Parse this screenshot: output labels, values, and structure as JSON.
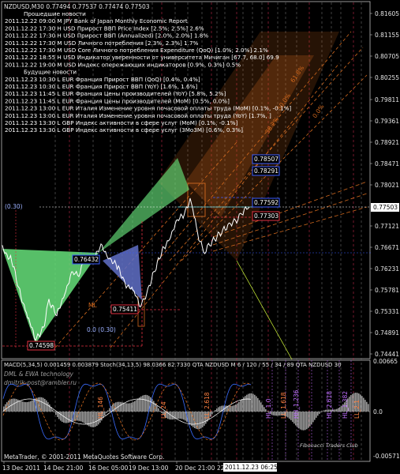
{
  "title": "NZDUSD,M30  0.77494 0.77537 0.77474 0.77503",
  "news": {
    "past_header": "Прошедшие новости",
    "past": [
      "2011.12.22 09:00 M JPY Bank of Japan Monthly Economic Report",
      "2011.12.22 17:30 H USD Прирост ВВП Price Index [2.5%; 2.5%] 2.6%",
      "2011.12.22 17:30 H USD Прирост ВВП (Annualized) [2.0%, 2.0%] 1.8%",
      "2011.12.22 17:30 M USD Личного потребления [2.3%, 2.3%] 1.7%",
      "2011.12.22 17:30 M USD Core Личного потребления Expenditure (QoQ) [1.0%; 2.0%] 2.1%",
      "2011.12.22 18:55 H USD Индикатор уверенности от университета Мичиган [67.7, 68.0] 69.9",
      "2011.12.22 19:00 M USD Индекс опережающих индикаторов [0.9%, 0.3%] 0.5%"
    ],
    "future_header": "Будущие новости",
    "future": [
      "2011.12.23 10:30 L EUR Франция Прирост ВВП (QoQ) [0.4%, 0.4%]",
      "2011.12.23 10:30 L EUR Франция Прирост ВВП (YoY) [1.6%, 1.6%]",
      "2011.12.23 11:45 L EUR Франция Цены производителей (YoY) [5.8%, 5.2%]",
      "2011.12.23 11:45 L EUR Франция Цены производителей (MoM) [0.5%, 0.0%]",
      "2011.12.23 13:00 L EUR Италия Изменение уровня почасовой оплаты труда (MoM) [0.1%, -0.1%]",
      "2011.12.23 13:00 L EUR Италия Изменение уровня почасовой оплаты труда (YoY) [1.7%, ]",
      "2011.12.23 13:30 L GBP Индекс активности в сфере услуг (MoM) [0.1%, -0.1%]",
      "2011.12.23 13:30 L GBP Индекс активности в сфере услуг (3Mo3M) [0.6%, 0.3%]"
    ]
  },
  "price_axis": [
    "0.81605",
    "0.81155",
    "0.80705",
    "0.80255",
    "0.79811",
    "0.79361",
    "0.78921",
    "0.78471",
    "0.78021",
    "0.77503",
    "0.77121",
    "0.76671",
    "0.76231",
    "0.75781",
    "0.75331",
    "0.74891",
    "0.74441"
  ],
  "price_boxes": {
    "current": "0.77503",
    "level_blue_1": "0.78507",
    "level_blue_2": "0.78291",
    "level_blue_3": "0.77592",
    "level_red": "0.77303",
    "left_blue": "0.76432",
    "mid_red": "0.75411",
    "low_red": "0.74598"
  },
  "fib_labels": [
    "61.8%",
    "50.0%",
    "38.2%",
    "0.0%"
  ],
  "small_labels": {
    "level_030": "(0.30)",
    "ml": "ML",
    "fib_low": "0.0 (0.30)"
  },
  "indicator": {
    "header": "MACD(5,34,5) 0.001459 0.003879  Stoch(34,13,5) 98.0366 82.7330  QTA NZDUSD M  6 / 120 / 55 / 34 / 89  QTA NZDUSD 30",
    "watermark_1": "DML & EWA  technology",
    "watermark_2": "dmitrik-post@rambler.ru",
    "signature": "Fibonacci Traders Club",
    "axis": [
      "0.00665",
      "0.0",
      "-0.00571"
    ],
    "vlabels": [
      "HL_146",
      "LL_24",
      "LL_2.618",
      "HL_1.0",
      "LL_1.618",
      "HH_1.236",
      "HL_2.618",
      "HL_1.382",
      "LL_2.1"
    ]
  },
  "footer": {
    "copyright": "MetaTrader, © 2001-2011 MetaQuotes Software Corp.",
    "dates": [
      "13 Dec 2011",
      "14 Dec 21:00",
      "16 Dec 05:00",
      "19 Dec 13:00",
      "20 Dec 21:00",
      "22"
    ],
    "cursor_time": "2011.12.23 06:25"
  },
  "colors": {
    "background": "#000000",
    "grid": "#4a4a4a",
    "fib_band": "#d2691e",
    "green_pattern": "#66e07a",
    "blue_pattern": "#6070c8",
    "red_line": "#e03040",
    "blue_box": "#3a5dff",
    "price": "#ffffff"
  }
}
